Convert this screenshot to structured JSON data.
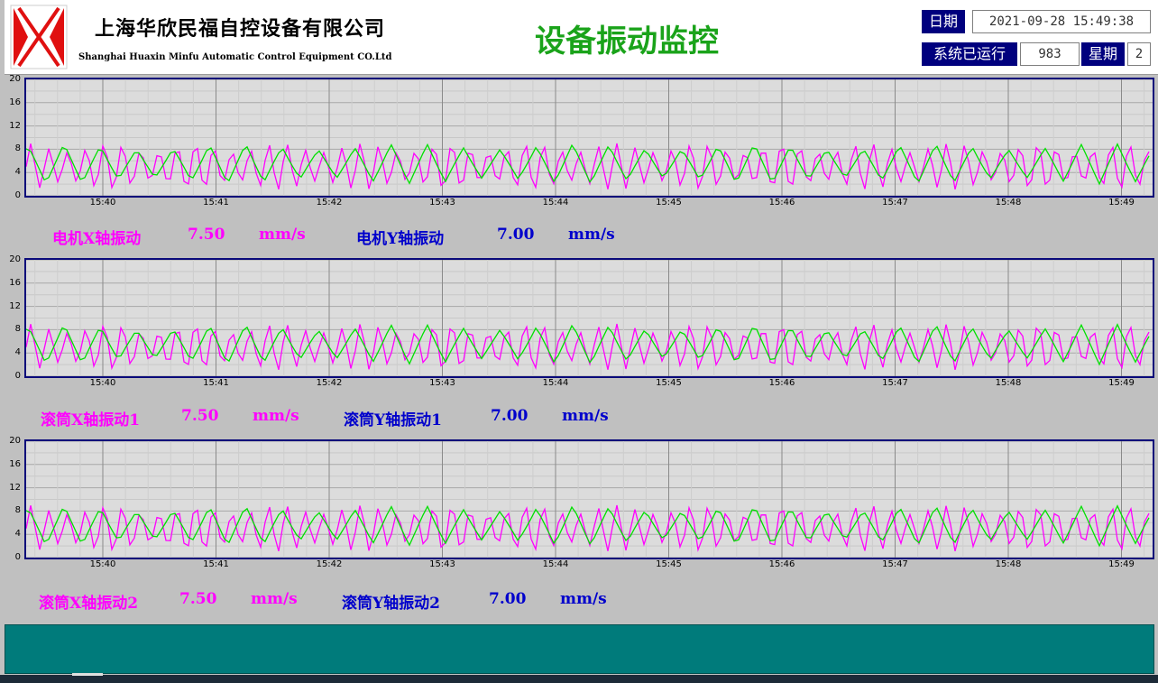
{
  "header": {
    "company_name_cn": "上海华欣民福自控设备有限公司",
    "company_name_en": "Shanghai Huaxin Minfu Automatic Control Equipment CO.Ltd",
    "page_title": "设备振动监控",
    "logo_icon": "hm-logo-icon"
  },
  "info": {
    "date_label": "日期",
    "date_value": "2021-09-28 15:49:38",
    "runtime_label": "系统已运行",
    "runtime_value": "983",
    "weekday_label": "星期",
    "weekday_value": "2"
  },
  "colors": {
    "x_series": "#ff00ff",
    "y_series": "#00e000",
    "title": "#1aa31a",
    "label_box": "#00007e",
    "chart_border": "#0a0a7a",
    "footer": "#007b7b"
  },
  "chart_data": [
    {
      "type": "line",
      "x": [
        "15:40",
        "15:41",
        "15:42",
        "15:43",
        "15:44",
        "15:45",
        "15:46",
        "15:47",
        "15:48",
        "15:49"
      ],
      "yticks": [
        0,
        4,
        8,
        12,
        16,
        20
      ],
      "ylim": [
        0,
        20
      ],
      "grid": true,
      "series": [
        {
          "color": "#ff00ff",
          "min": 1,
          "max": 9,
          "pattern": "sawtooth"
        },
        {
          "color": "#00e000",
          "min": 2,
          "max": 9,
          "pattern": "triangle"
        }
      ]
    },
    {
      "type": "line",
      "x": [
        "15:40",
        "15:41",
        "15:42",
        "15:43",
        "15:44",
        "15:45",
        "15:46",
        "15:47",
        "15:48",
        "15:49"
      ],
      "yticks": [
        0,
        4,
        8,
        12,
        16,
        20
      ],
      "ylim": [
        0,
        20
      ],
      "grid": true,
      "series": [
        {
          "color": "#ff00ff",
          "min": 1,
          "max": 9,
          "pattern": "sawtooth"
        },
        {
          "color": "#00e000",
          "min": 2,
          "max": 9,
          "pattern": "triangle"
        }
      ]
    },
    {
      "type": "line",
      "x": [
        "15:40",
        "15:41",
        "15:42",
        "15:43",
        "15:44",
        "15:45",
        "15:46",
        "15:47",
        "15:48",
        "15:49"
      ],
      "yticks": [
        0,
        4,
        8,
        12,
        16,
        20
      ],
      "ylim": [
        0,
        20
      ],
      "grid": true,
      "series": [
        {
          "color": "#ff00ff",
          "min": 1,
          "max": 9,
          "pattern": "sawtooth"
        },
        {
          "color": "#00e000",
          "min": 2,
          "max": 9,
          "pattern": "triangle"
        }
      ]
    }
  ],
  "readouts": [
    {
      "x_label": "电机X轴振动",
      "x_value": "7.50",
      "x_unit": "mm/s",
      "y_label": "电机Y轴振动",
      "y_value": "7.00",
      "y_unit": "mm/s"
    },
    {
      "x_label": "滚筒X轴振动1",
      "x_value": "7.50",
      "x_unit": "mm/s",
      "y_label": "滚筒Y轴振动1",
      "y_value": "7.00",
      "y_unit": "mm/s"
    },
    {
      "x_label": "滚筒X轴振动2",
      "x_value": "7.50",
      "x_unit": "mm/s",
      "y_label": "滚筒Y轴振动2",
      "y_value": "7.00",
      "y_unit": "mm/s"
    }
  ]
}
